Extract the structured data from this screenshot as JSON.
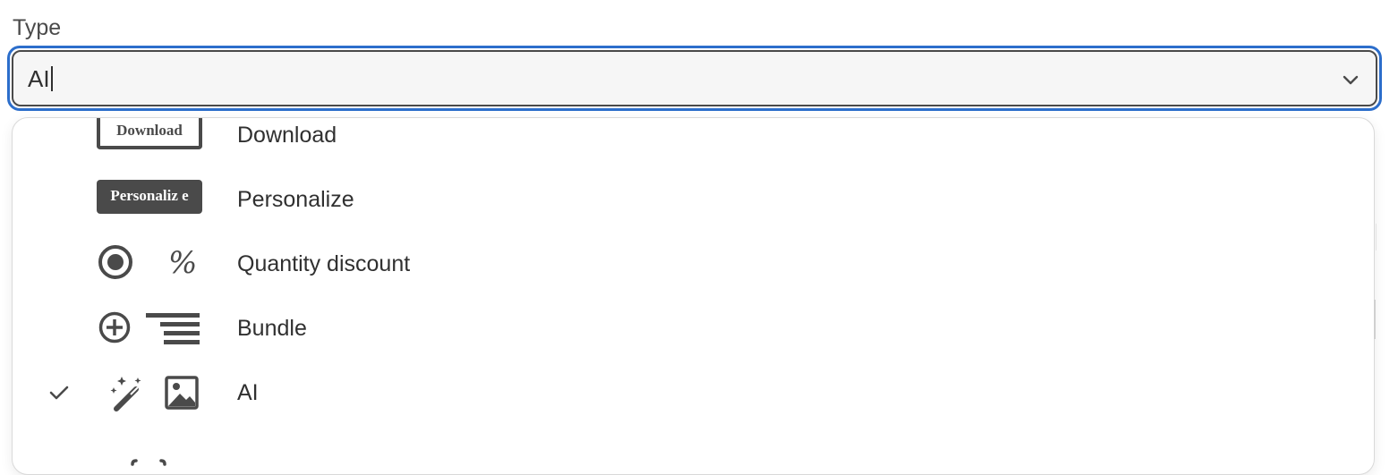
{
  "field": {
    "label": "Type",
    "value": "AI"
  },
  "options": [
    {
      "label": "Download",
      "badge_text": "Download",
      "icon": "download-badge-icon",
      "selected": false
    },
    {
      "label": "Personalize",
      "badge_text": "Personaliz e",
      "icon": "personalize-badge-icon",
      "selected": false
    },
    {
      "label": "Quantity discount",
      "icon": "radio-percent-icon",
      "selected": false
    },
    {
      "label": "Bundle",
      "icon": "plus-list-icon",
      "selected": false
    },
    {
      "label": "AI",
      "icon": "magic-wand-image-icon",
      "selected": true
    }
  ],
  "colors": {
    "focus_ring": "#2c6ecb",
    "icon": "#4a4a4a",
    "text": "#303030"
  }
}
